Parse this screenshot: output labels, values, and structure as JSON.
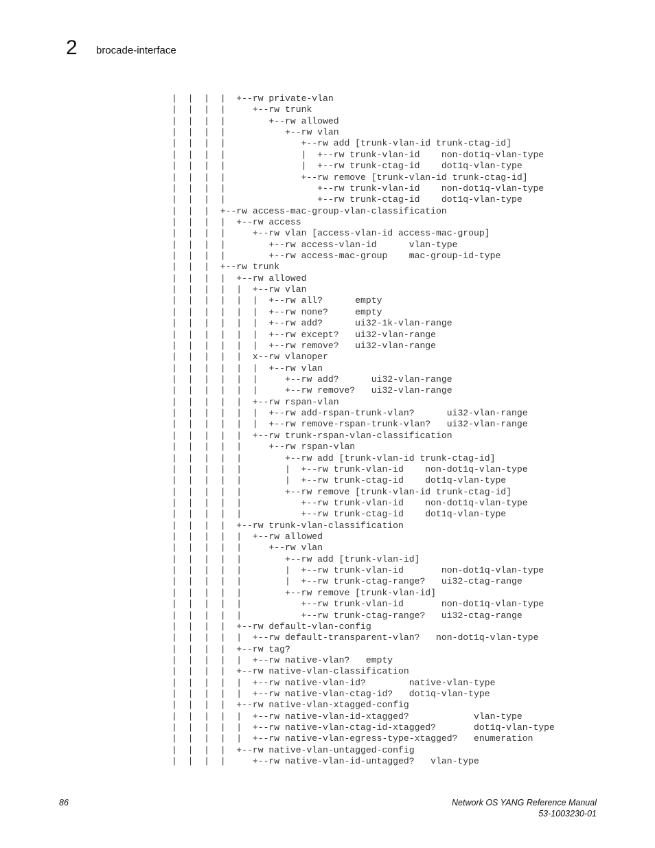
{
  "header": {
    "chapter_number": "2",
    "chapter_title": "brocade-interface"
  },
  "code_lines": [
    "|  |  |  |  +--rw private-vlan",
    "|  |  |  |     +--rw trunk",
    "|  |  |  |        +--rw allowed",
    "|  |  |  |           +--rw vlan",
    "|  |  |  |              +--rw add [trunk-vlan-id trunk-ctag-id]",
    "|  |  |  |              |  +--rw trunk-vlan-id    non-dot1q-vlan-type",
    "|  |  |  |              |  +--rw trunk-ctag-id    dot1q-vlan-type",
    "|  |  |  |              +--rw remove [trunk-vlan-id trunk-ctag-id]",
    "|  |  |  |                 +--rw trunk-vlan-id    non-dot1q-vlan-type",
    "|  |  |  |                 +--rw trunk-ctag-id    dot1q-vlan-type",
    "|  |  |  +--rw access-mac-group-vlan-classification",
    "|  |  |  |  +--rw access",
    "|  |  |  |     +--rw vlan [access-vlan-id access-mac-group]",
    "|  |  |  |        +--rw access-vlan-id      vlan-type",
    "|  |  |  |        +--rw access-mac-group    mac-group-id-type",
    "|  |  |  +--rw trunk",
    "|  |  |  |  +--rw allowed",
    "|  |  |  |  |  +--rw vlan",
    "|  |  |  |  |  |  +--rw all?      empty",
    "|  |  |  |  |  |  +--rw none?     empty",
    "|  |  |  |  |  |  +--rw add?      ui32-1k-vlan-range",
    "|  |  |  |  |  |  +--rw except?   ui32-vlan-range",
    "|  |  |  |  |  |  +--rw remove?   ui32-vlan-range",
    "|  |  |  |  |  x--rw vlanoper",
    "|  |  |  |  |  |  +--rw vlan",
    "|  |  |  |  |  |     +--rw add?      ui32-vlan-range",
    "|  |  |  |  |  |     +--rw remove?   ui32-vlan-range",
    "|  |  |  |  |  +--rw rspan-vlan",
    "|  |  |  |  |  |  +--rw add-rspan-trunk-vlan?      ui32-vlan-range",
    "|  |  |  |  |  |  +--rw remove-rspan-trunk-vlan?   ui32-vlan-range",
    "|  |  |  |  |  +--rw trunk-rspan-vlan-classification",
    "|  |  |  |  |     +--rw rspan-vlan",
    "|  |  |  |  |        +--rw add [trunk-vlan-id trunk-ctag-id]",
    "|  |  |  |  |        |  +--rw trunk-vlan-id    non-dot1q-vlan-type",
    "|  |  |  |  |        |  +--rw trunk-ctag-id    dot1q-vlan-type",
    "|  |  |  |  |        +--rw remove [trunk-vlan-id trunk-ctag-id]",
    "|  |  |  |  |           +--rw trunk-vlan-id    non-dot1q-vlan-type",
    "|  |  |  |  |           +--rw trunk-ctag-id    dot1q-vlan-type",
    "|  |  |  |  +--rw trunk-vlan-classification",
    "|  |  |  |  |  +--rw allowed",
    "|  |  |  |  |     +--rw vlan",
    "|  |  |  |  |        +--rw add [trunk-vlan-id]",
    "|  |  |  |  |        |  +--rw trunk-vlan-id       non-dot1q-vlan-type",
    "|  |  |  |  |        |  +--rw trunk-ctag-range?   ui32-ctag-range",
    "|  |  |  |  |        +--rw remove [trunk-vlan-id]",
    "|  |  |  |  |           +--rw trunk-vlan-id       non-dot1q-vlan-type",
    "|  |  |  |  |           +--rw trunk-ctag-range?   ui32-ctag-range",
    "|  |  |  |  +--rw default-vlan-config",
    "|  |  |  |  |  +--rw default-transparent-vlan?   non-dot1q-vlan-type",
    "|  |  |  |  +--rw tag?",
    "|  |  |  |  |  +--rw native-vlan?   empty",
    "|  |  |  |  +--rw native-vlan-classification",
    "|  |  |  |  |  +--rw native-vlan-id?        native-vlan-type",
    "|  |  |  |  |  +--rw native-vlan-ctag-id?   dot1q-vlan-type",
    "|  |  |  |  +--rw native-vlan-xtagged-config",
    "|  |  |  |  |  +--rw native-vlan-id-xtagged?            vlan-type",
    "|  |  |  |  |  +--rw native-vlan-ctag-id-xtagged?       dot1q-vlan-type",
    "|  |  |  |  |  +--rw native-vlan-egress-type-xtagged?   enumeration",
    "|  |  |  |  +--rw native-vlan-untagged-config",
    "|  |  |  |     +--rw native-vlan-id-untagged?   vlan-type"
  ],
  "footer": {
    "page_number": "86",
    "manual_title": "Network OS YANG Reference Manual",
    "doc_number": "53-1003230-01"
  }
}
